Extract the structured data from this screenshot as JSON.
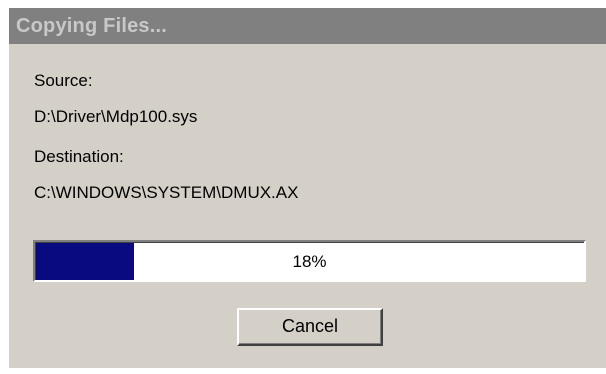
{
  "dialog": {
    "title": "Copying Files...",
    "source_label": "Source:",
    "source_path": "D:\\Driver\\Mdp100.sys",
    "destination_label": "Destination:",
    "destination_path": "C:\\WINDOWS\\SYSTEM\\DMUX.AX",
    "progress": {
      "percent": 18,
      "text": "18%",
      "fill_color": "#0a0a80"
    },
    "cancel_label": "Cancel"
  },
  "colors": {
    "dialog_face": "#d4d0c8",
    "titlebar_inactive": "#808080",
    "title_text_inactive": "#c8c8c8"
  }
}
